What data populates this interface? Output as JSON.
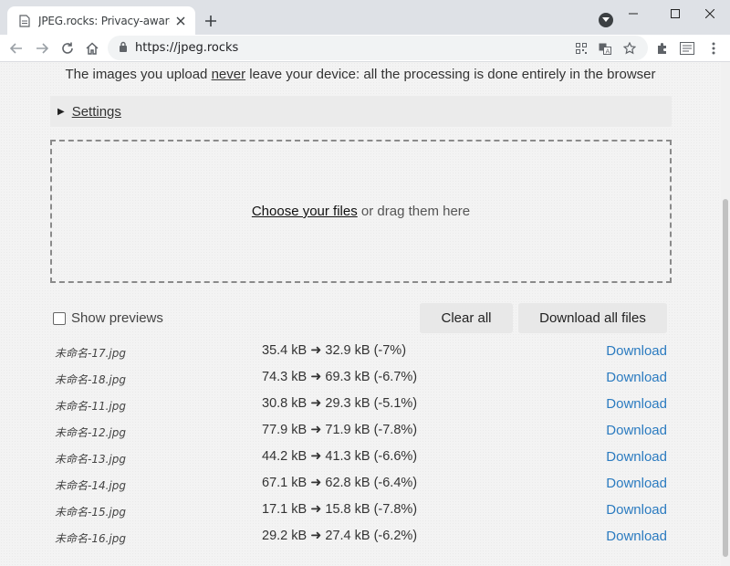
{
  "browser": {
    "tab_title": "JPEG.rocks: Privacy-aware JPEG",
    "url": "https://jpeg.rocks"
  },
  "page": {
    "privacy_before": "The images you upload ",
    "privacy_emphasis": "never",
    "privacy_after": " leave your device: all the processing is done entirely in the browser",
    "settings_label": "Settings",
    "dropzone_link": "Choose your files",
    "dropzone_text": " or drag them here",
    "show_previews_label": "Show previews",
    "clear_all_label": "Clear all",
    "download_all_label": "Download all files"
  },
  "files": [
    {
      "name": "未命名-17.jpg",
      "size": "35.4 kB ➜ 32.9 kB (-7%)",
      "action": "Download"
    },
    {
      "name": "未命名-18.jpg",
      "size": "74.3 kB ➜ 69.3 kB (-6.7%)",
      "action": "Download"
    },
    {
      "name": "未命名-11.jpg",
      "size": "30.8 kB ➜ 29.3 kB (-5.1%)",
      "action": "Download"
    },
    {
      "name": "未命名-12.jpg",
      "size": "77.9 kB ➜ 71.9 kB (-7.8%)",
      "action": "Download"
    },
    {
      "name": "未命名-13.jpg",
      "size": "44.2 kB ➜ 41.3 kB (-6.6%)",
      "action": "Download"
    },
    {
      "name": "未命名-14.jpg",
      "size": "67.1 kB ➜ 62.8 kB (-6.4%)",
      "action": "Download"
    },
    {
      "name": "未命名-15.jpg",
      "size": "17.1 kB ➜ 15.8 kB (-7.8%)",
      "action": "Download"
    },
    {
      "name": "未命名-16.jpg",
      "size": "29.2 kB ➜ 27.4 kB (-6.2%)",
      "action": "Download"
    }
  ],
  "icons": [
    "page-icon",
    "close-icon",
    "plus-icon",
    "profile-icon",
    "minimize-icon",
    "maximize-icon",
    "window-close-icon",
    "back-icon",
    "forward-icon",
    "reload-icon",
    "home-icon",
    "lock-icon",
    "qr-code-icon",
    "translate-icon",
    "star-icon",
    "extensions-icon",
    "reading-list-icon",
    "menu-icon"
  ],
  "colors": {
    "link": "#2b7bc0",
    "page_bg": "#f3f3f3",
    "chrome_bg": "#dee1e6"
  }
}
